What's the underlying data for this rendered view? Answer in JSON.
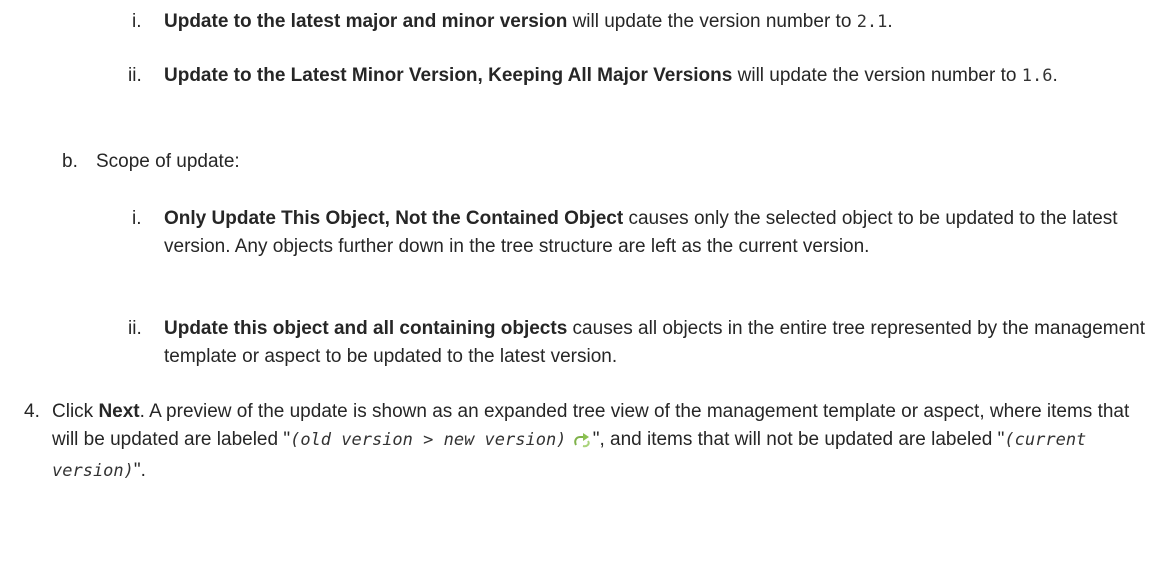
{
  "ma_i": {
    "marker": "i.",
    "bold": "Update to the latest major and minor version",
    "text": " will update the version number to ",
    "code": "2.1",
    "end": "."
  },
  "ma_ii": {
    "marker": "ii.",
    "bold": "Update to the Latest Minor Version, Keeping All Major Versions",
    "text": " will update the version number to ",
    "code": "1.6",
    "end": "."
  },
  "b": {
    "marker": "b.",
    "text": "Scope of update:"
  },
  "sb_i": {
    "marker": "i.",
    "bold": "Only Update This Object, Not the Contained Object",
    "text": " causes only the selected object to be updated to the latest version. Any objects further down in the tree structure are left as the current version."
  },
  "sb_ii": {
    "marker": "ii.",
    "bold": "Update this object and all containing objects",
    "text": " causes all objects in the entire tree represented by the management template or aspect to be updated to the latest version."
  },
  "step4": {
    "marker": "4.",
    "t1": "Click ",
    "bold": "Next",
    "t2": ". A preview of the update is shown as an expanded tree view of the management template or aspect, where items that will be updated are labeled \"",
    "code1": "(old version > new version)",
    "t3": "\", and items that will not be updated are labeled \"",
    "code2": "(current version)",
    "t4": "\".",
    "icon": "update-arrow-icon"
  }
}
